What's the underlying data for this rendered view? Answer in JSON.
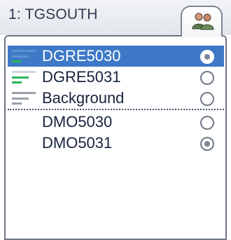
{
  "header": {
    "title": "1: TGSOUTH",
    "tab_icon": "group-users-icon"
  },
  "rows": [
    {
      "label": "DGRE5030",
      "level_icon": "level-bars-icon",
      "selected": true,
      "radio_checked": true
    },
    {
      "label": "DGRE5031",
      "level_icon": "level-bars-icon",
      "selected": false,
      "radio_checked": false
    },
    {
      "label": "Background",
      "level_icon": "level-bars-icon",
      "selected": false,
      "radio_checked": false
    },
    {
      "label": "DMO5030",
      "selected": false,
      "radio_checked": false
    },
    {
      "label": "DMO5031",
      "selected": false,
      "radio_checked": true
    }
  ],
  "colors": {
    "selection": "#3d79c6",
    "level_active": "#2cb35a",
    "level_inactive": "#9aa0aa"
  }
}
